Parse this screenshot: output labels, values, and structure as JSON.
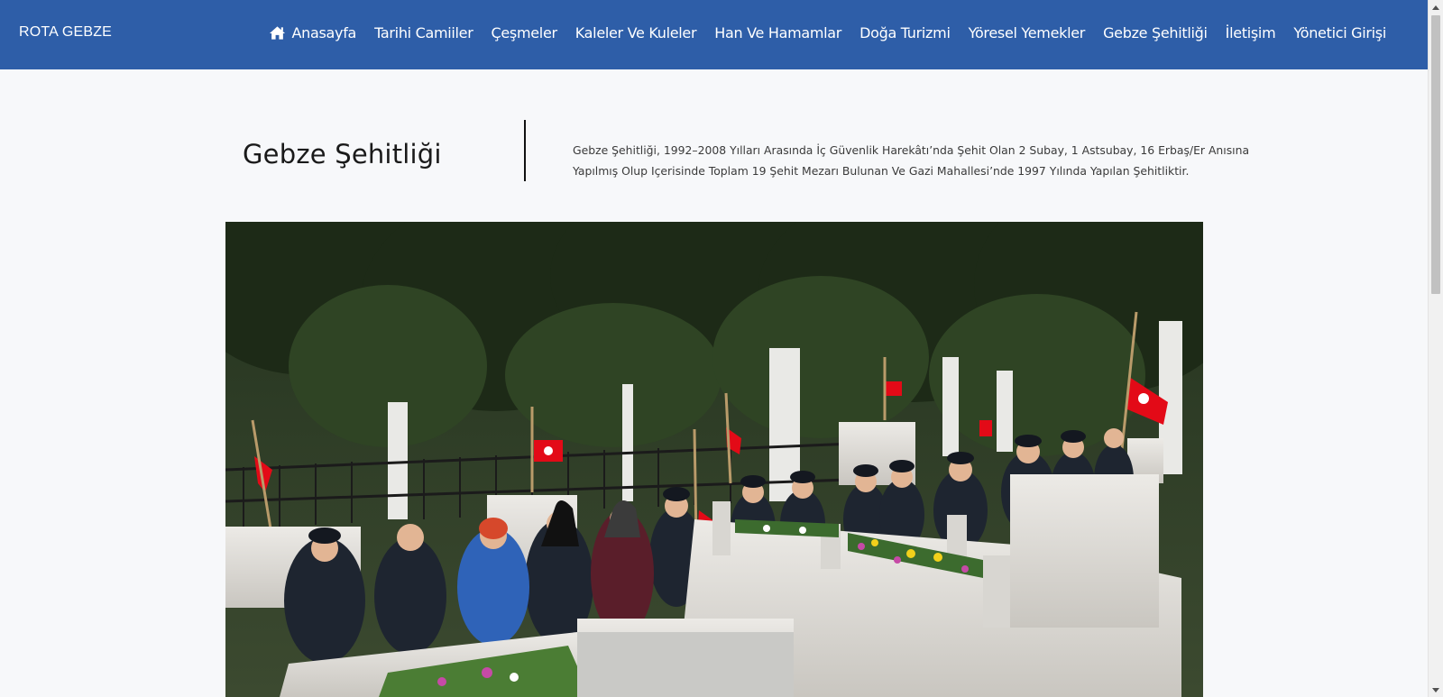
{
  "brand": "ROTA GEBZE",
  "nav": {
    "items": [
      {
        "label": "Anasayfa",
        "icon": "home-icon"
      },
      {
        "label": "Tarihi Camiiler"
      },
      {
        "label": "Çeşmeler"
      },
      {
        "label": "Kaleler Ve Kuleler"
      },
      {
        "label": "Han Ve Hamamlar"
      },
      {
        "label": "Doğa Turizmi"
      },
      {
        "label": "Yöresel Yemekler"
      },
      {
        "label": "Gebze Şehitliği"
      },
      {
        "label": "İletişim"
      },
      {
        "label": "Yönetici Girişi"
      }
    ]
  },
  "page": {
    "title": "Gebze Şehitliği",
    "description": "Gebze Şehitliği, 1992–2008 Yılları Arasında İç Güvenlik Harekâtı’nda Şehit Olan 2 Subay, 1 Astsubay, 16 Erbaş/Er Anısına Yapılmış Olup Içerisinde Toplam 19 Şehit Mezarı Bulunan Ve Gazi Mahallesi’nde 1997 Yılında Yapılan Şehitliktir."
  },
  "colors": {
    "navbar": "#2e5ea8",
    "background": "#f7f8fa",
    "flag": "#e30a17"
  }
}
